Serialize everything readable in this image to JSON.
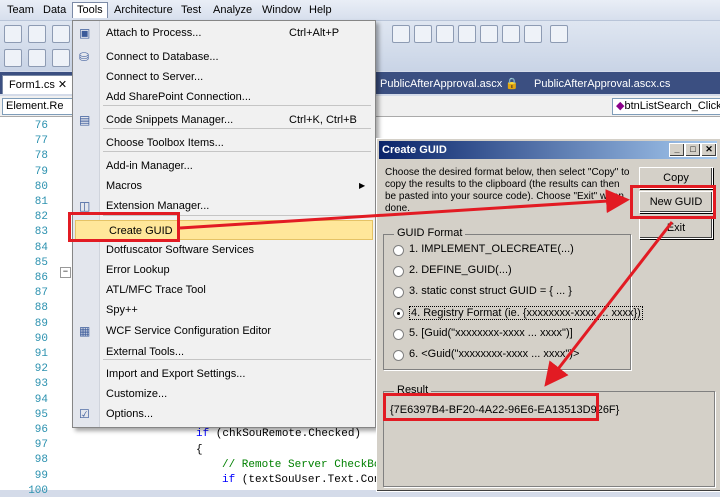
{
  "menubar": {
    "items": [
      "Team",
      "Data",
      "Tools",
      "Architecture",
      "Test",
      "Analyze",
      "Window",
      "Help"
    ],
    "active": "Tools"
  },
  "tabs": [
    {
      "label": "Form1.cs"
    },
    {
      "label": "PublicAfterApproval.ascx"
    },
    {
      "label": "PublicAfterApproval.ascx.cs"
    }
  ],
  "nav": {
    "left": "Element.Re",
    "right": "btnListSearch_Click("
  },
  "editor": {
    "line_numbers": [
      "76",
      "77",
      "78",
      "79",
      "80",
      "81",
      "82",
      "83",
      "84",
      "85",
      "86",
      "87",
      "88",
      "89",
      "90",
      "91",
      "92",
      "93",
      "94",
      "95",
      "96",
      "97",
      "98",
      "99",
      "100"
    ],
    "code": {
      "l97_kw": "if",
      "l97_rest": " (chkSouRemote.Checked)",
      "l98": "{",
      "l99": "// Remote Server CheckBo",
      "l100_kw": "if",
      "l100_rest": " (textSouUser.Text.Con"
    }
  },
  "tools_menu": {
    "items": [
      {
        "label": "Attach to Process...",
        "shortcut": "Ctrl+Alt+P",
        "icon": "attach-process-icon"
      },
      {
        "label": "Connect to Database...",
        "shortcut": "",
        "icon": "database-icon"
      },
      {
        "label": "Connect to Server...",
        "shortcut": "",
        "icon": ""
      },
      {
        "label": "Add SharePoint Connection...",
        "shortcut": "",
        "icon": ""
      },
      {
        "label": "Code Snippets Manager...",
        "shortcut": "Ctrl+K, Ctrl+B",
        "icon": "snippets-icon"
      },
      {
        "label": "Choose Toolbox Items...",
        "shortcut": "",
        "icon": ""
      },
      {
        "label": "Add-in Manager...",
        "shortcut": "",
        "icon": ""
      },
      {
        "label": "Macros",
        "shortcut": "",
        "icon": ""
      },
      {
        "label": "Extension Manager...",
        "shortcut": "",
        "icon": "extension-icon"
      },
      {
        "label": "Create GUID",
        "shortcut": "",
        "icon": ""
      },
      {
        "label": "Dotfuscator Software Services",
        "shortcut": "",
        "icon": ""
      },
      {
        "label": "Error Lookup",
        "shortcut": "",
        "icon": ""
      },
      {
        "label": "ATL/MFC Trace Tool",
        "shortcut": "",
        "icon": ""
      },
      {
        "label": "Spy++",
        "shortcut": "",
        "icon": ""
      },
      {
        "label": "WCF Service Configuration Editor",
        "shortcut": "",
        "icon": "wcf-icon"
      },
      {
        "label": "External Tools...",
        "shortcut": "",
        "icon": ""
      },
      {
        "label": "Import and Export Settings...",
        "shortcut": "",
        "icon": ""
      },
      {
        "label": "Customize...",
        "shortcut": "",
        "icon": ""
      },
      {
        "label": "Options...",
        "shortcut": "",
        "icon": "options-icon"
      }
    ]
  },
  "dialog": {
    "title": "Create GUID",
    "instructions": "Choose the desired format below, then select \"Copy\" to copy the results to the clipboard (the results can then be pasted into your source code). Choose \"Exit\" when done.",
    "buttons": {
      "copy": "Copy",
      "new_guid": "New GUID",
      "exit": "Exit"
    },
    "format_group": "GUID Format",
    "formats": [
      "1. IMPLEMENT_OLECREATE(...)",
      "2. DEFINE_GUID(...)",
      "3. static const struct GUID = { ... }",
      "4. Registry Format (ie. {xxxxxxxx-xxxx ... xxxx})",
      "5. [Guid(\"xxxxxxxx-xxxx ... xxxx\")]",
      "6. <Guid(\"xxxxxxxx-xxxx ... xxxx\")>"
    ],
    "selected_format": 4,
    "result_group": "Result",
    "result": "{7E6397B4-BF20-4A22-96E6-EA13513D926F}"
  },
  "colors": {
    "annotation": "#e21b23",
    "highlight": "#ffe79a"
  }
}
